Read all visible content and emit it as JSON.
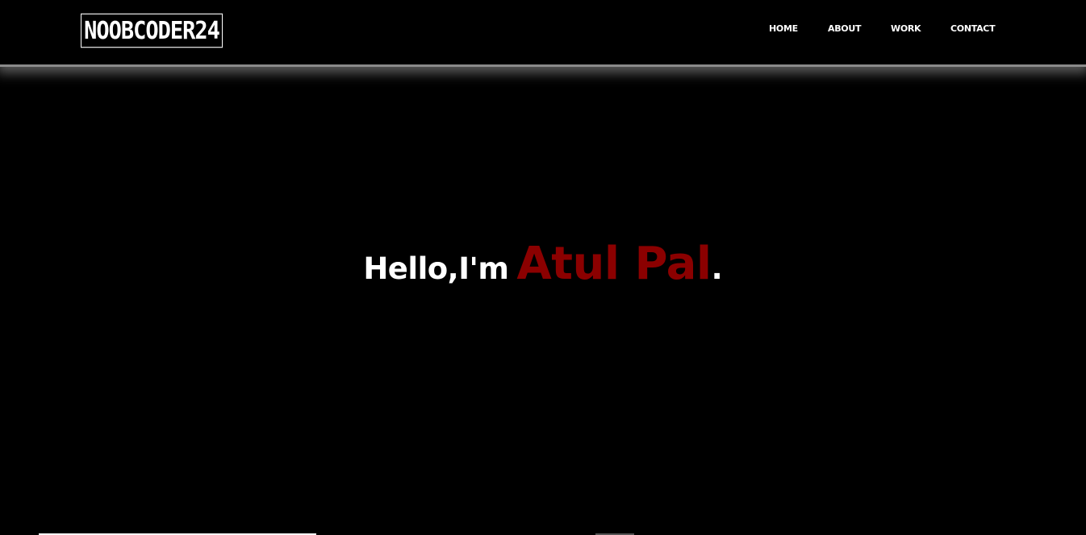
{
  "header": {
    "logo_text": "NOOBCODER24",
    "nav": {
      "home": "HOME",
      "about": "ABOUT",
      "work": "WORK",
      "contact": "CONTACT"
    }
  },
  "hero": {
    "greeting": "Hello,I'm",
    "name": "Atul Pal",
    "punctuation": "."
  },
  "colors": {
    "background": "#000000",
    "text": "#ffffff",
    "accent": "#8b0000"
  }
}
